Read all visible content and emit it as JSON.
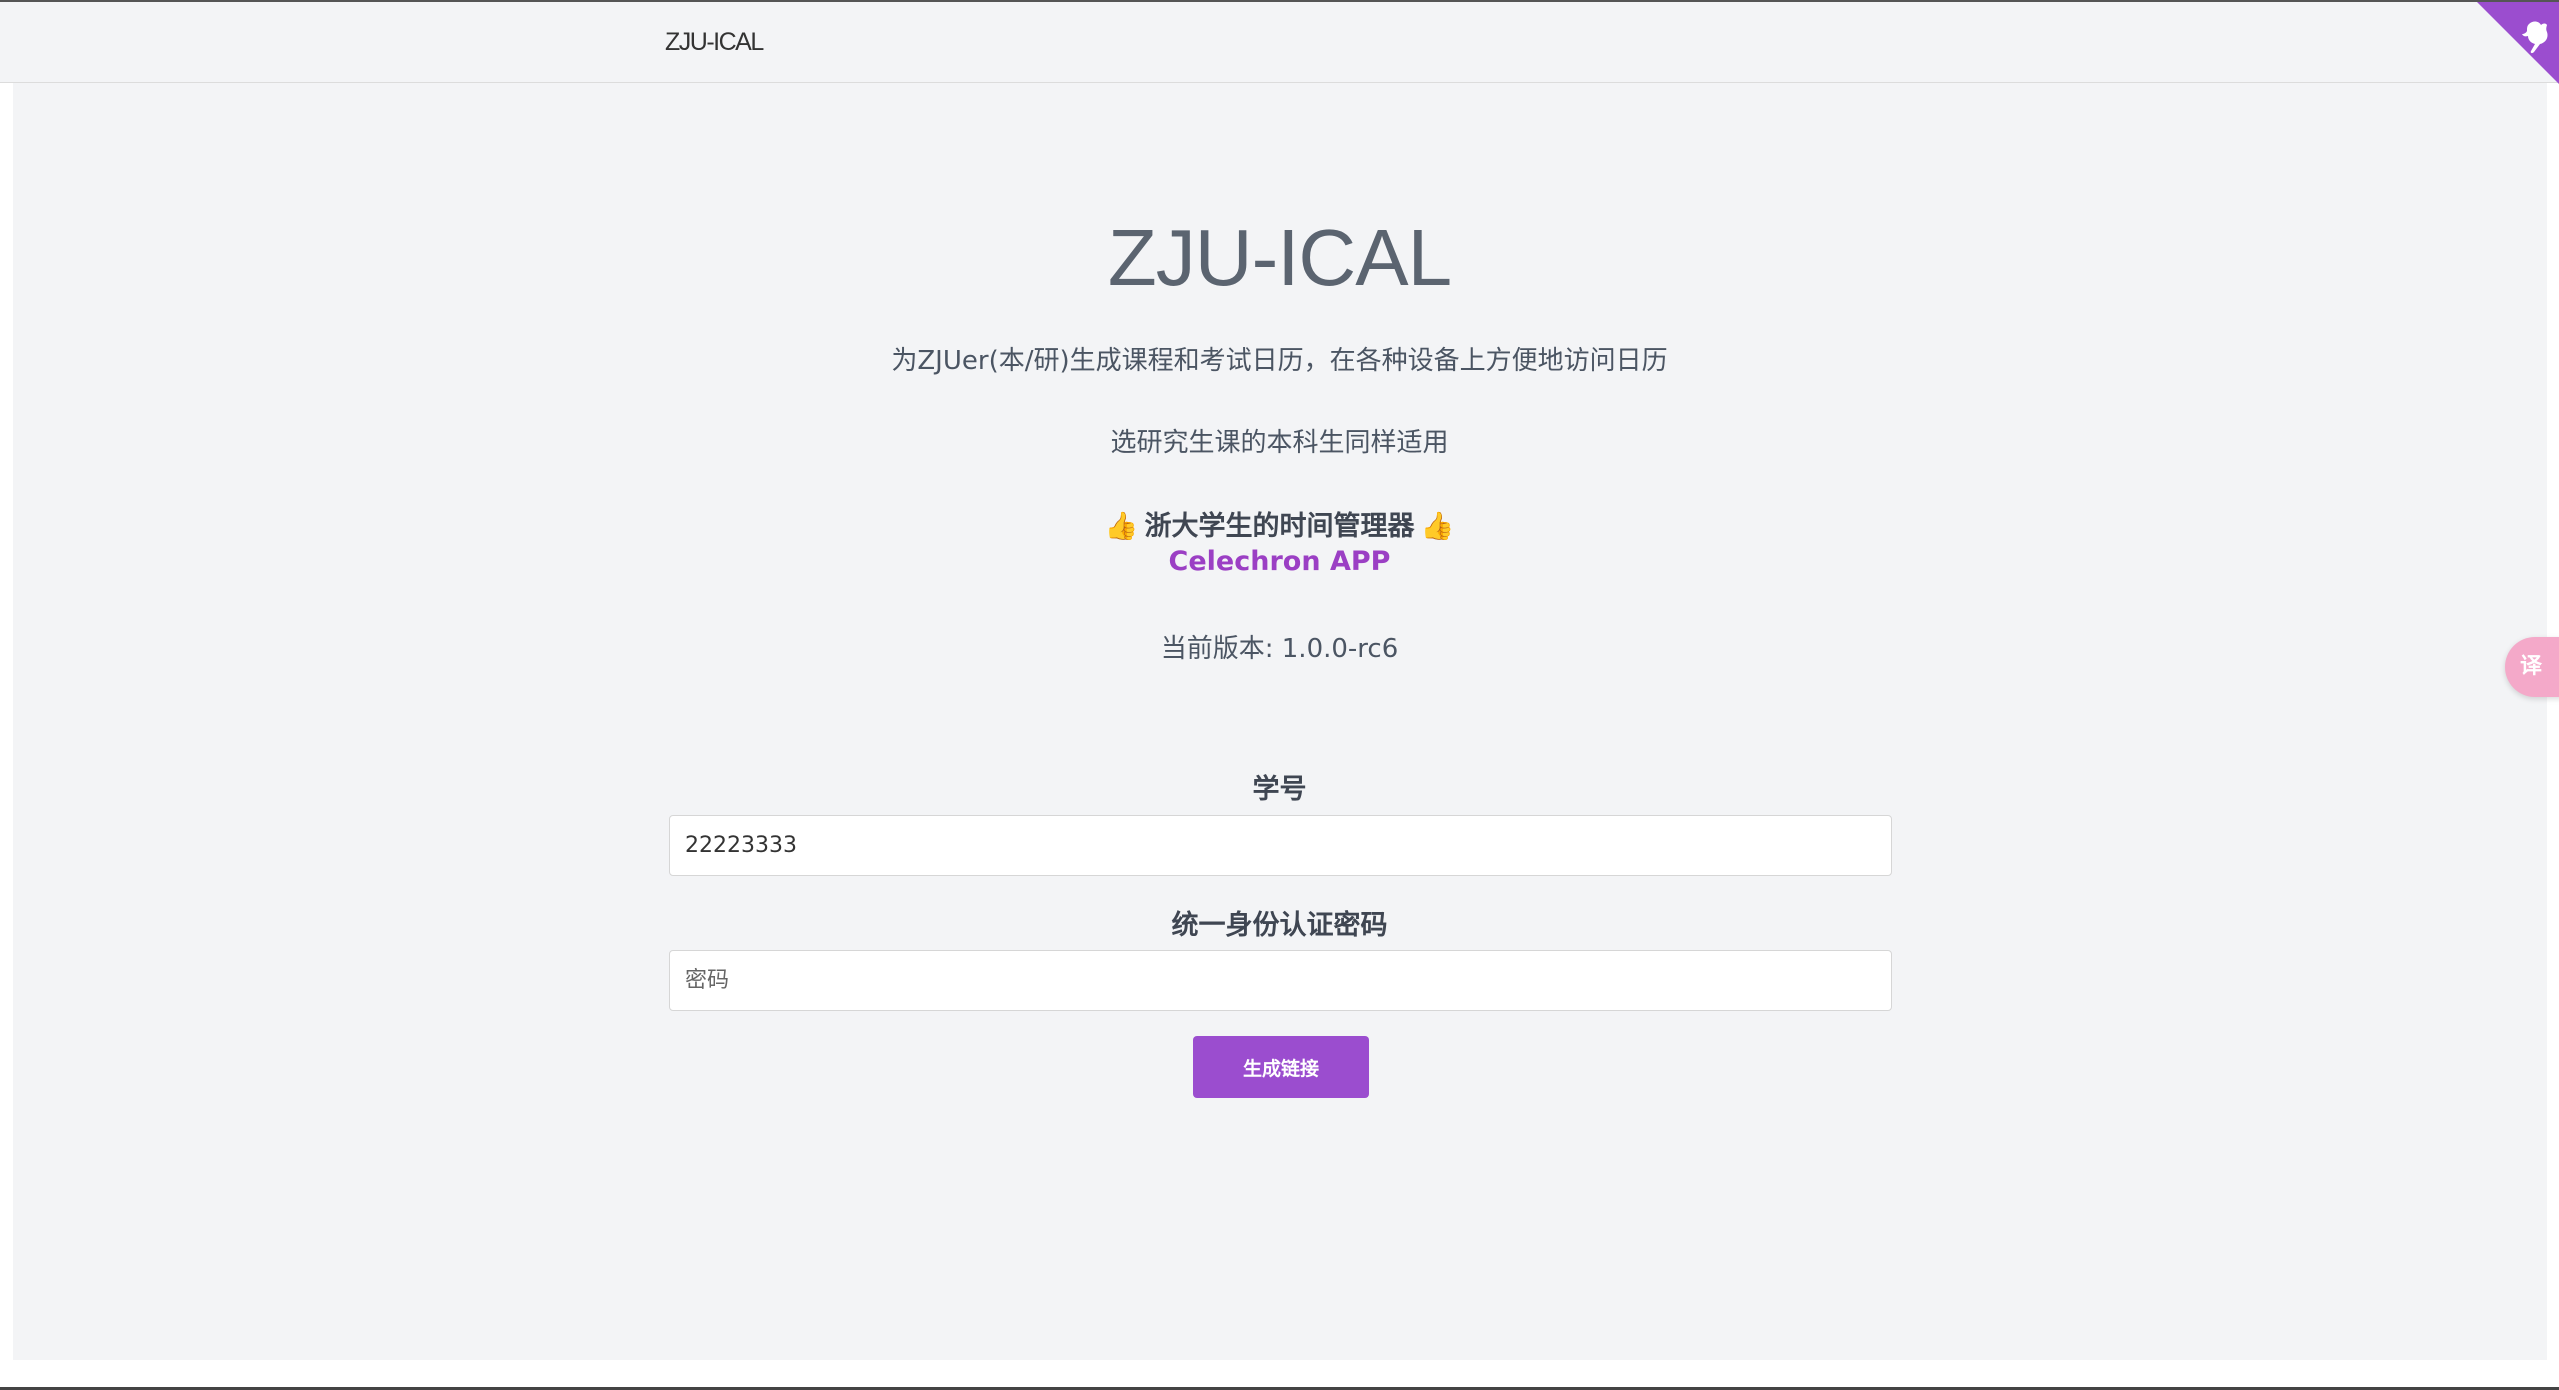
{
  "navbar": {
    "brand": "ZJU-ICAL"
  },
  "main": {
    "title": "ZJU-ICAL",
    "description": "为ZJUer(本/研)生成课程和考试日历，在各种设备上方便地访问日历",
    "note": "选研究生课的本科生同样适用",
    "promo_text": "浙大学生的时间管理器",
    "promo_emoji": "👍",
    "app_link": "Celechron APP",
    "version": "当前版本: 1.0.0-rc6"
  },
  "form": {
    "student_id_label": "学号",
    "student_id_value": "22223333",
    "password_label": "统一身份认证密码",
    "password_placeholder": "密码",
    "submit_label": "生成链接"
  },
  "widgets": {
    "translate_glyph": "译",
    "corner_icon": "github-icon"
  },
  "colors": {
    "accent": "#9b4dcf",
    "link": "#9b3fc4",
    "background": "#f3f4f6"
  }
}
